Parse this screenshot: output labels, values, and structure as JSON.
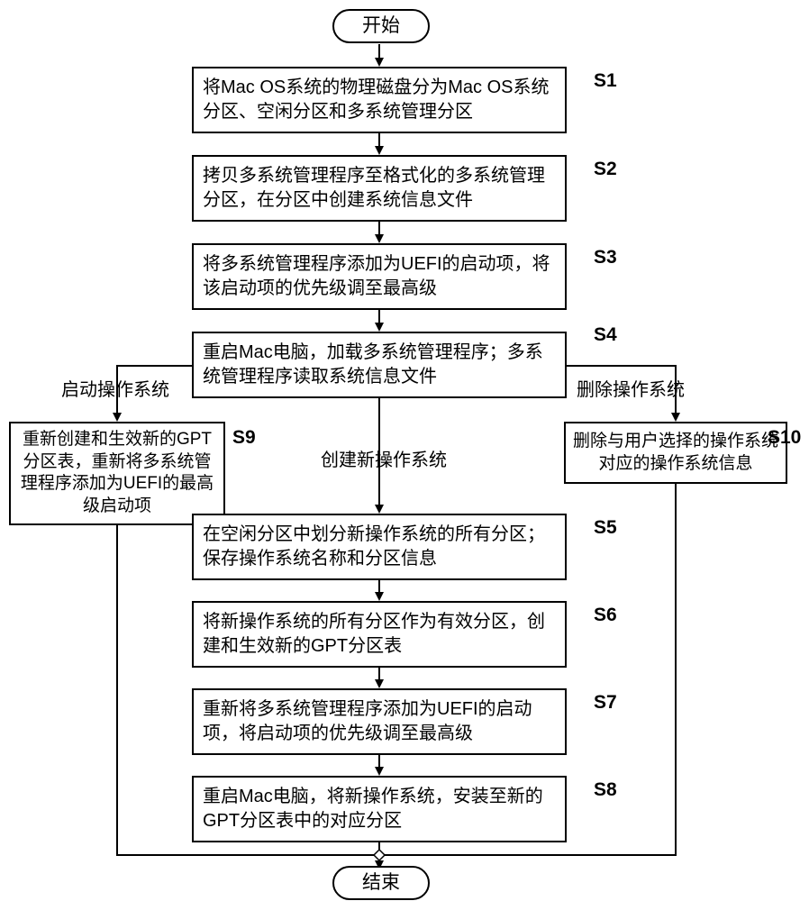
{
  "terminals": {
    "start": "开始",
    "end": "结束"
  },
  "steps": {
    "s1": "将Mac OS系统的物理磁盘分为Mac OS系统分区、空闲分区和多系统管理分区",
    "s2": "拷贝多系统管理程序至格式化的多系统管理分区，在分区中创建系统信息文件",
    "s3": "将多系统管理程序添加为UEFI的启动项，将该启动项的优先级调至最高级",
    "s4": "重启Mac电脑，加载多系统管理程序；多系统管理程序读取系统信息文件",
    "s5": "在空闲分区中划分新操作系统的所有分区；保存操作系统名称和分区信息",
    "s6": "将新操作系统的所有分区作为有效分区，创建和生效新的GPT分区表",
    "s7": "重新将多系统管理程序添加为UEFI的启动项，将启动项的优先级调至最高级",
    "s8": "重启Mac电脑，将新操作系统，安装至新的GPT分区表中的对应分区",
    "s9": "重新创建和生效新的GPT分区表，重新将多系统管理程序添加为UEFI的最高级启动项",
    "s10": "删除与用户选择的操作系统对应的操作系统信息"
  },
  "step_markers": {
    "s1": "S1",
    "s2": "S2",
    "s3": "S3",
    "s4": "S4",
    "s5": "S5",
    "s6": "S6",
    "s7": "S7",
    "s8": "S8",
    "s9": "S9",
    "s10": "S10"
  },
  "branches": {
    "boot_os": "启动操作系统",
    "create_os": "创建新操作系统",
    "delete_os": "删除操作系统"
  },
  "chart_data": {
    "type": "flowchart",
    "nodes": [
      {
        "id": "start",
        "kind": "terminal",
        "text": "开始"
      },
      {
        "id": "S1",
        "kind": "process",
        "text": "将Mac OS系统的物理磁盘分为Mac OS系统分区、空闲分区和多系统管理分区"
      },
      {
        "id": "S2",
        "kind": "process",
        "text": "拷贝多系统管理程序至格式化的多系统管理分区，在分区中创建系统信息文件"
      },
      {
        "id": "S3",
        "kind": "process",
        "text": "将多系统管理程序添加为UEFI的启动项，将该启动项的优先级调至最高级"
      },
      {
        "id": "S4",
        "kind": "process",
        "text": "重启Mac电脑，加载多系统管理程序；多系统管理程序读取系统信息文件"
      },
      {
        "id": "S5",
        "kind": "process",
        "text": "在空闲分区中划分新操作系统的所有分区；保存操作系统名称和分区信息"
      },
      {
        "id": "S6",
        "kind": "process",
        "text": "将新操作系统的所有分区作为有效分区，创建和生效新的GPT分区表"
      },
      {
        "id": "S7",
        "kind": "process",
        "text": "重新将多系统管理程序添加为UEFI的启动项，将启动项的优先级调至最高级"
      },
      {
        "id": "S8",
        "kind": "process",
        "text": "重启Mac电脑，将新操作系统，安装至新的GPT分区表中的对应分区"
      },
      {
        "id": "S9",
        "kind": "process",
        "text": "重新创建和生效新的GPT分区表，重新将多系统管理程序添加为UEFI的最高级启动项"
      },
      {
        "id": "S10",
        "kind": "process",
        "text": "删除与用户选择的操作系统对应的操作系统信息"
      },
      {
        "id": "end",
        "kind": "terminal",
        "text": "结束"
      }
    ],
    "edges": [
      {
        "from": "start",
        "to": "S1"
      },
      {
        "from": "S1",
        "to": "S2"
      },
      {
        "from": "S2",
        "to": "S3"
      },
      {
        "from": "S3",
        "to": "S4"
      },
      {
        "from": "S4",
        "to": "S9",
        "label": "启动操作系统"
      },
      {
        "from": "S4",
        "to": "S5",
        "label": "创建新操作系统"
      },
      {
        "from": "S4",
        "to": "S10",
        "label": "删除操作系统"
      },
      {
        "from": "S5",
        "to": "S6"
      },
      {
        "from": "S6",
        "to": "S7"
      },
      {
        "from": "S7",
        "to": "S8"
      },
      {
        "from": "S8",
        "to": "end"
      },
      {
        "from": "S9",
        "to": "end"
      },
      {
        "from": "S10",
        "to": "end"
      }
    ]
  }
}
